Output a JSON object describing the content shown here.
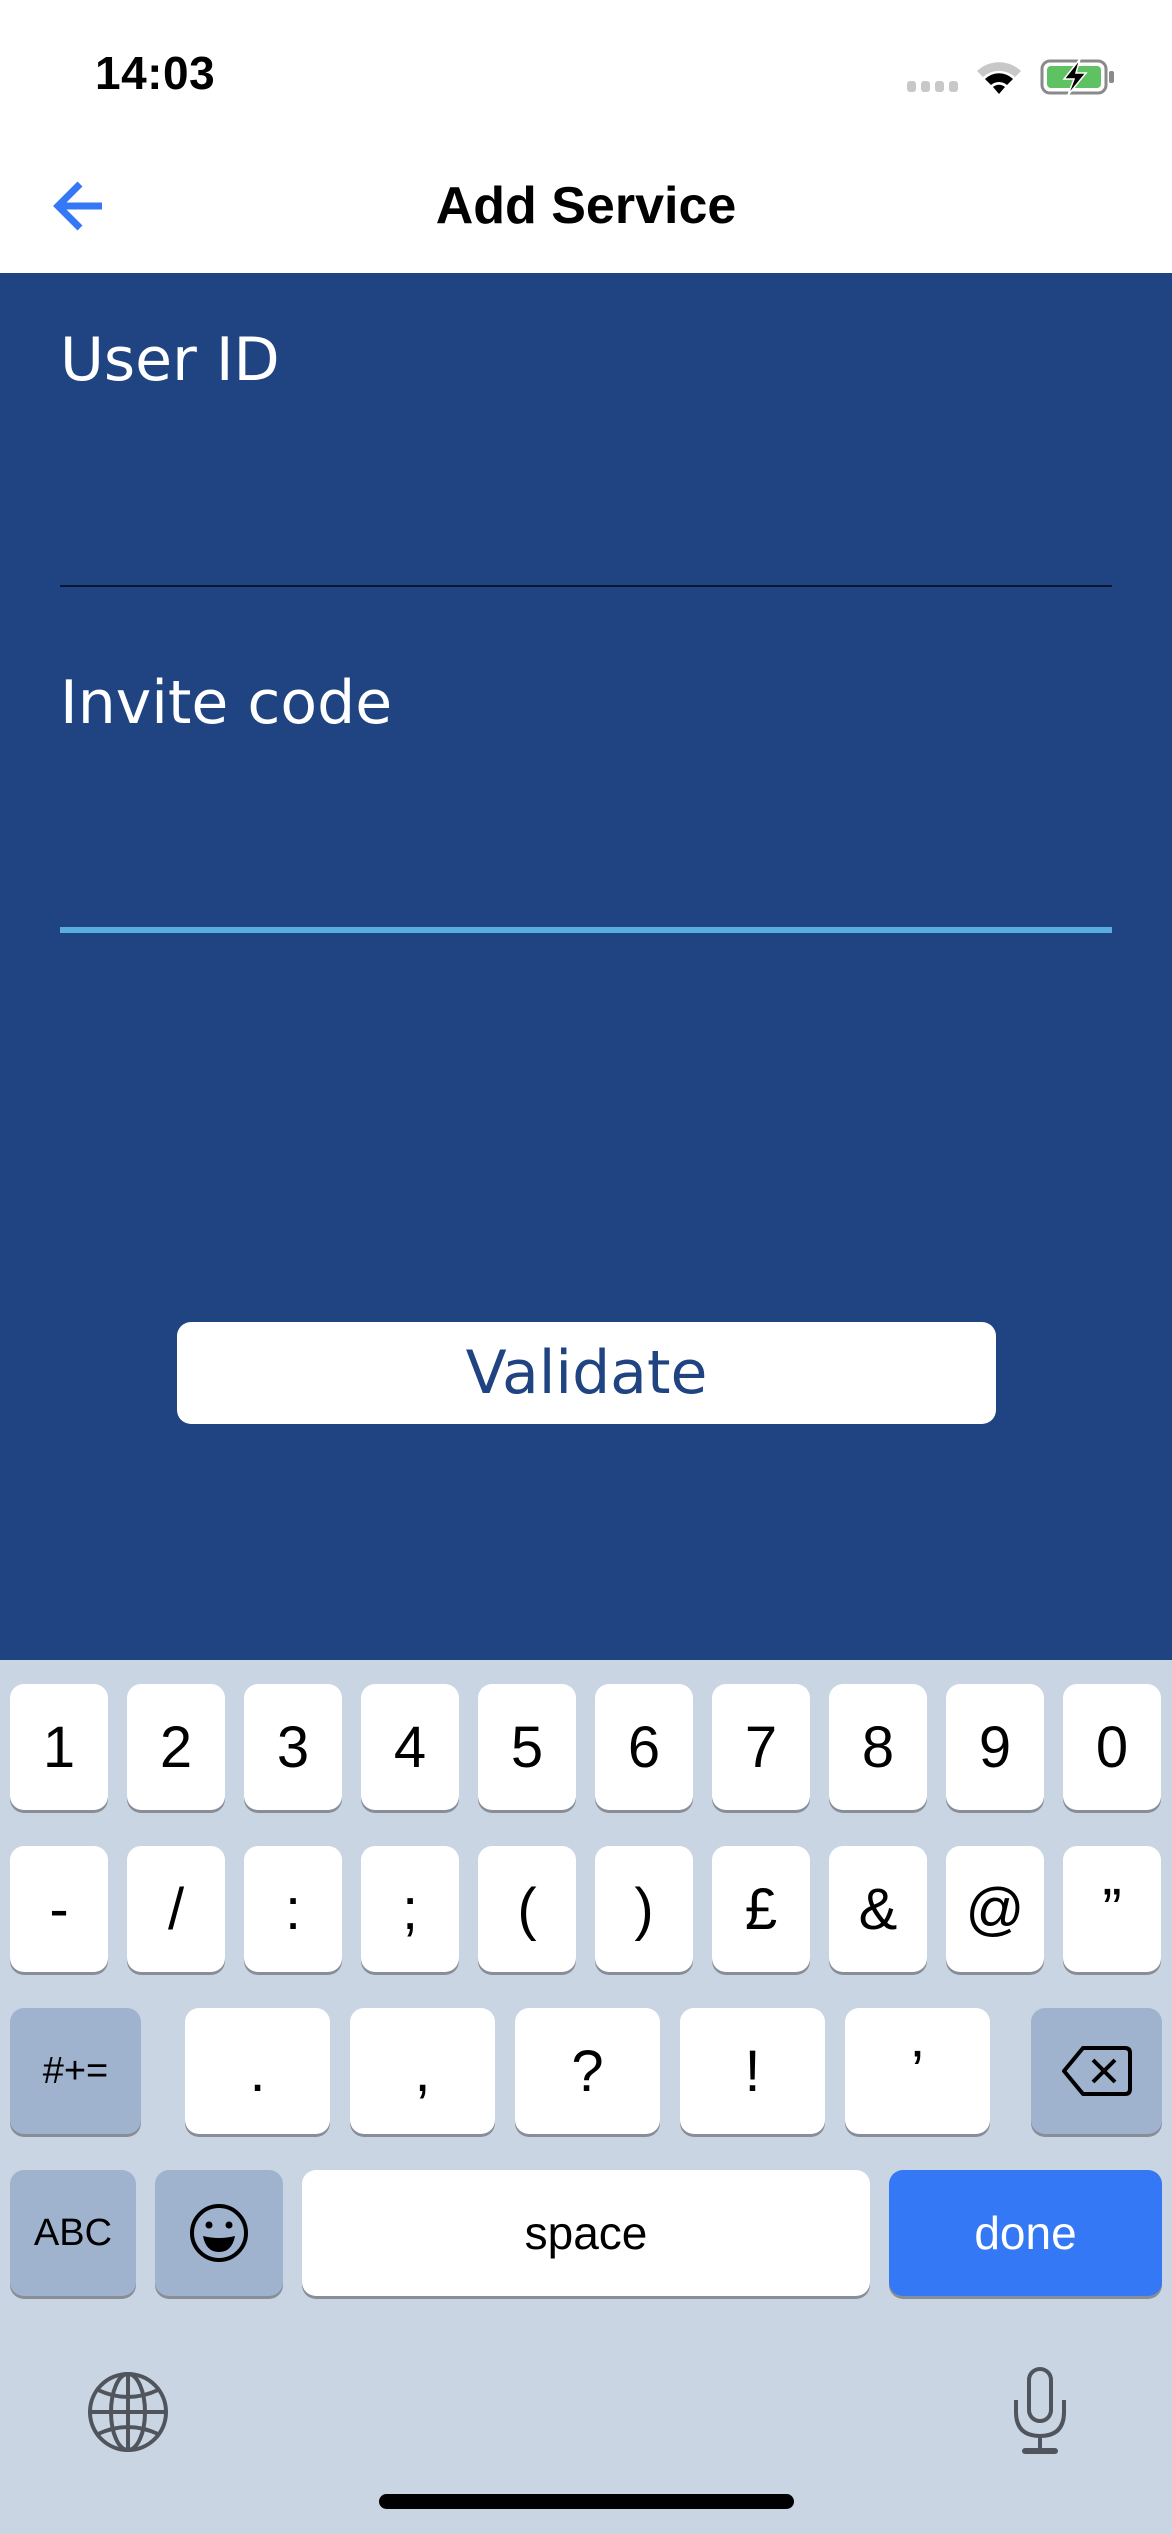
{
  "status_bar": {
    "time": "14:03",
    "icons": [
      "signal-icon",
      "wifi-icon",
      "battery-charging-icon"
    ],
    "battery_color": "#5ec162"
  },
  "nav": {
    "title": "Add Service",
    "back_icon": "arrow-left-icon",
    "accent_color": "#3478f6"
  },
  "form": {
    "background_color": "#1f4481",
    "fields": [
      {
        "label": "User ID",
        "value": "",
        "placeholder": ""
      },
      {
        "label": "Invite code",
        "value": "",
        "placeholder": "",
        "focused": true
      }
    ],
    "validate_label": "Validate"
  },
  "keyboard": {
    "row1": [
      "1",
      "2",
      "3",
      "4",
      "5",
      "6",
      "7",
      "8",
      "9",
      "0"
    ],
    "row2": [
      "-",
      "/",
      ":",
      ";",
      "(",
      ")",
      "£",
      "&",
      "@",
      "”"
    ],
    "row3_left": "#+=",
    "row3": [
      ".",
      ",",
      "?",
      "!",
      "’"
    ],
    "row3_right_icon": "backspace-icon",
    "row4": {
      "abc": "ABC",
      "emoji_icon": "emoji-icon",
      "space": "space",
      "done": "done"
    },
    "bottom_icons": [
      "globe-icon",
      "microphone-icon"
    ]
  }
}
